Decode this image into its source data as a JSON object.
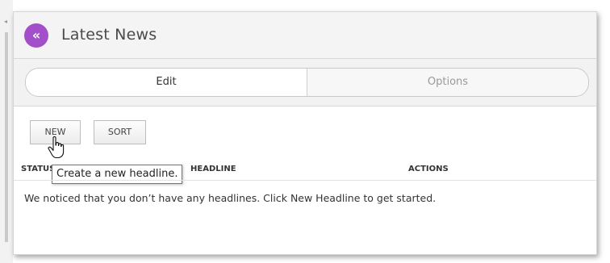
{
  "panel": {
    "title": "Latest News",
    "back_icon": "chevron-double-left-icon",
    "accent_color": "#a24fc9"
  },
  "tabs": [
    {
      "label": "Edit",
      "active": true
    },
    {
      "label": "Options",
      "active": false
    }
  ],
  "toolbar": {
    "new_label": "NEW",
    "sort_label": "SORT"
  },
  "tooltip": {
    "text": "Create a new headline."
  },
  "table": {
    "columns": [
      "STATUS",
      "HEADLINE",
      "ACTIONS"
    ]
  },
  "empty_message": "We noticed that you don’t have any headlines. Click New Headline to get started."
}
